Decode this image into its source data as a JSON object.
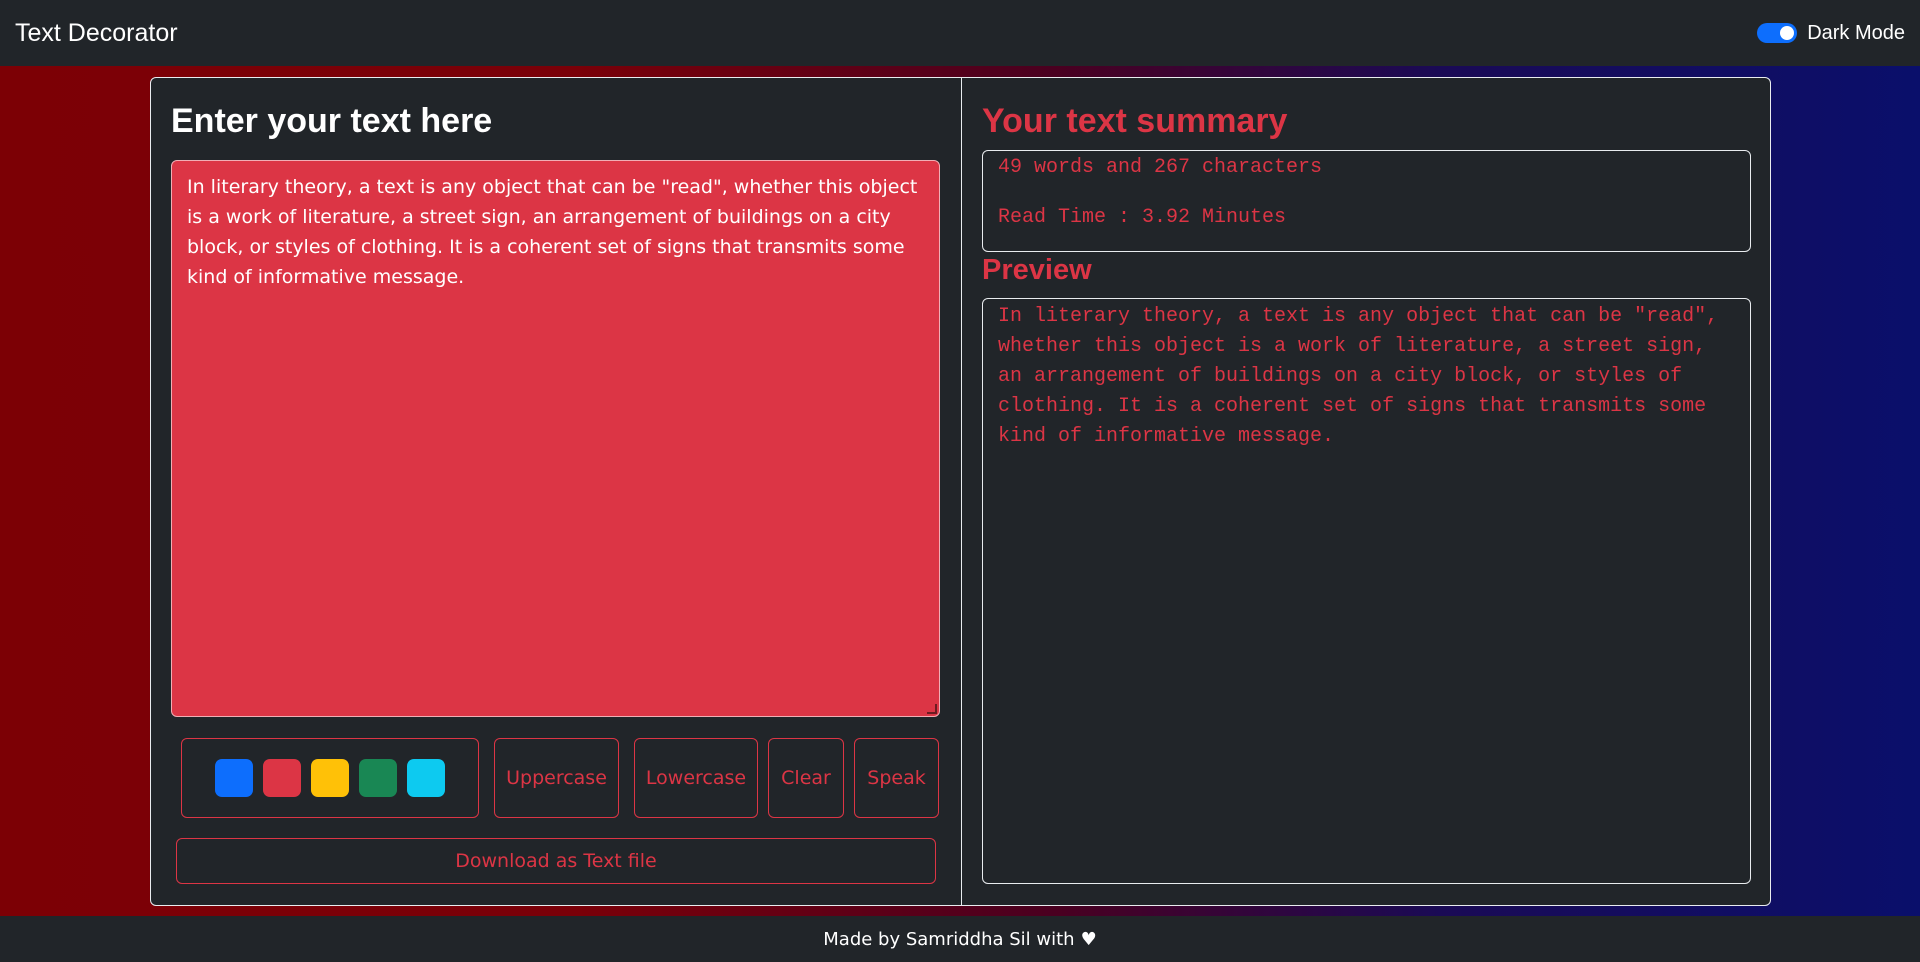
{
  "navbar": {
    "brand": "Text Decorator",
    "dark_mode_label": "Dark Mode",
    "dark_mode_on": true
  },
  "editor": {
    "title": "Enter your text here",
    "text": "In literary theory, a text is any object that can be \"read\", whether this object is a work of literature, a street sign, an arrangement of buildings on a city block, or styles of clothing. It is a coherent set of signs that transmits some kind of informative message.",
    "swatches": [
      {
        "name": "blue",
        "color": "#0d6efd"
      },
      {
        "name": "red",
        "color": "#dc3545"
      },
      {
        "name": "yellow",
        "color": "#ffc107"
      },
      {
        "name": "green",
        "color": "#198754"
      },
      {
        "name": "cyan",
        "color": "#0dcaf0"
      }
    ],
    "buttons": {
      "uppercase": "Uppercase",
      "lowercase": "Lowercase",
      "clear": "Clear",
      "speak": "Speak",
      "download": "Download as Text file"
    }
  },
  "summary": {
    "title": "Your text summary",
    "counts": "49 words and 267 characters",
    "read_time": "Read Time : 3.92 Minutes"
  },
  "preview": {
    "title": "Preview",
    "text": "In literary theory, a text is any object that can be \"read\", whether this object is a work of literature, a street sign, an arrangement of buildings on a city block, or styles of clothing. It is a coherent set of signs that transmits some kind of informative message."
  },
  "footer": {
    "text": "Made by Samriddha Sil with",
    "icon": "heart-icon"
  },
  "colors": {
    "accent": "#dc3545",
    "toggle": "#0d6efd",
    "background": "#212529"
  }
}
